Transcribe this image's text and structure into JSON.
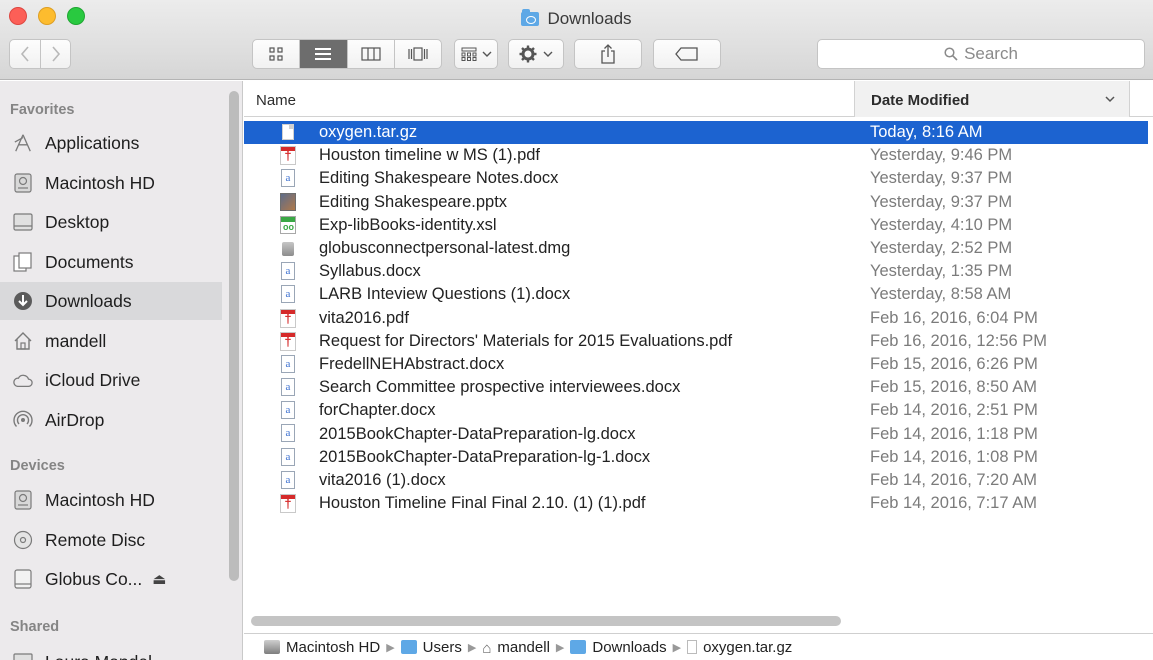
{
  "window": {
    "title": "Downloads"
  },
  "toolbar": {
    "back_icon": "chevron-left",
    "forward_icon": "chevron-right",
    "view_modes": [
      "icon",
      "list",
      "column",
      "cover-flow"
    ],
    "active_view": "list",
    "search_placeholder": "Search"
  },
  "sidebar": {
    "sections": [
      {
        "heading": "Favorites",
        "items": [
          {
            "label": "Applications",
            "icon": "applications-icon"
          },
          {
            "label": "Macintosh HD",
            "icon": "harddrive-icon"
          },
          {
            "label": "Desktop",
            "icon": "desktop-icon"
          },
          {
            "label": "Documents",
            "icon": "documents-icon"
          },
          {
            "label": "Downloads",
            "icon": "downloads-icon",
            "selected": true
          },
          {
            "label": "mandell",
            "icon": "home-icon"
          },
          {
            "label": "iCloud Drive",
            "icon": "cloud-icon"
          },
          {
            "label": "AirDrop",
            "icon": "airdrop-icon"
          }
        ]
      },
      {
        "heading": "Devices",
        "items": [
          {
            "label": "Macintosh HD",
            "icon": "harddrive-icon"
          },
          {
            "label": "Remote Disc",
            "icon": "disc-icon"
          },
          {
            "label": "Globus Co...",
            "icon": "drive-icon",
            "eject": "⏏"
          }
        ]
      },
      {
        "heading": "Shared",
        "items": [
          {
            "label": "Laura Mandel",
            "icon": "computer-icon"
          }
        ]
      }
    ]
  },
  "columns": {
    "name": "Name",
    "date_modified": "Date Modified"
  },
  "files": [
    {
      "name": "oxygen.tar.gz",
      "date": "Today, 8:16 AM",
      "type": "gz",
      "selected": true
    },
    {
      "name": "Houston timeline w MS (1).pdf",
      "date": "Yesterday, 9:46 PM",
      "type": "pdf"
    },
    {
      "name": "Editing Shakespeare Notes.docx",
      "date": "Yesterday, 9:37 PM",
      "type": "docx"
    },
    {
      "name": "Editing Shakespeare.pptx",
      "date": "Yesterday, 9:37 PM",
      "type": "pptx"
    },
    {
      "name": "Exp-libBooks-identity.xsl",
      "date": "Yesterday, 4:10 PM",
      "type": "xsl"
    },
    {
      "name": "globusconnectpersonal-latest.dmg",
      "date": "Yesterday, 2:52 PM",
      "type": "dmg"
    },
    {
      "name": "Syllabus.docx",
      "date": "Yesterday, 1:35 PM",
      "type": "docx"
    },
    {
      "name": "LARB Inteview Questions (1).docx",
      "date": "Yesterday, 8:58 AM",
      "type": "docx"
    },
    {
      "name": "vita2016.pdf",
      "date": "Feb 16, 2016, 6:04 PM",
      "type": "pdf"
    },
    {
      "name": "Request for Directors' Materials for 2015 Evaluations.pdf",
      "date": "Feb 16, 2016, 12:56 PM",
      "type": "pdf"
    },
    {
      "name": "FredellNEHAbstract.docx",
      "date": "Feb 15, 2016, 6:26 PM",
      "type": "docx"
    },
    {
      "name": "Search Committee prospective interviewees.docx",
      "date": "Feb 15, 2016, 8:50 AM",
      "type": "docx"
    },
    {
      "name": "forChapter.docx",
      "date": "Feb 14, 2016, 2:51 PM",
      "type": "docx"
    },
    {
      "name": "2015BookChapter-DataPreparation-lg.docx",
      "date": "Feb 14, 2016, 1:18 PM",
      "type": "docx"
    },
    {
      "name": "2015BookChapter-DataPreparation-lg-1.docx",
      "date": "Feb 14, 2016, 1:08 PM",
      "type": "docx"
    },
    {
      "name": "vita2016 (1).docx",
      "date": "Feb 14, 2016, 7:20 AM",
      "type": "docx"
    },
    {
      "name": "Houston Timeline Final Final 2.10. (1) (1).pdf",
      "date": "Feb 14, 2016, 7:17 AM",
      "type": "pdf"
    }
  ],
  "path_bar": [
    {
      "label": "Macintosh HD",
      "icon": "harddrive-icon"
    },
    {
      "label": "Users",
      "icon": "folder-icon"
    },
    {
      "label": "mandell",
      "icon": "home-icon"
    },
    {
      "label": "Downloads",
      "icon": "downloads-folder-icon"
    },
    {
      "label": "oxygen.tar.gz",
      "icon": "file-icon"
    }
  ],
  "colors": {
    "selection": "#1c63d0",
    "sidebar_bg": "#eceaec",
    "folder_blue": "#5ea8e6"
  }
}
